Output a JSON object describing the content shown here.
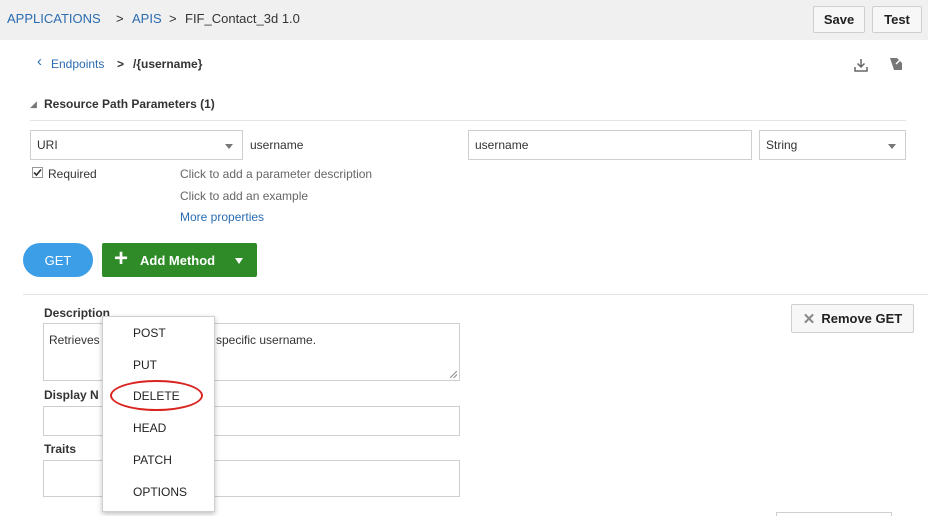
{
  "breadcrumb": {
    "applications": "APPLICATIONS",
    "sep1": ">",
    "apis": "APIS",
    "sep2": ">",
    "current": "FIF_Contact_3d  1.0"
  },
  "toolbar": {
    "save_label": "Save",
    "test_label": "Test"
  },
  "subnav": {
    "back_glyph": "‹",
    "endpoints_label": "Endpoints",
    "sep": ">",
    "path": "/{username}"
  },
  "section": {
    "toggle_glyph": "◢",
    "title": "Resource Path Parameters (1)"
  },
  "param": {
    "type_value": "URI",
    "name_value": "username",
    "display_value": "username",
    "datatype_value": "String",
    "required_label": "Required",
    "required_checked": true,
    "description_hint": "Click to add a parameter description",
    "example_hint": "Click to add an example",
    "more_properties": "More properties"
  },
  "methods": {
    "get_label": "GET",
    "add_plus": "+",
    "add_label": "Add Method"
  },
  "method_panel": {
    "description_label": "Description",
    "description_value_left": "Retrieves",
    "description_value_right": "specific username.",
    "display_name_label_visible": "Display N",
    "traits_label": "Traits",
    "remove_glyph": "✕",
    "remove_label": "Remove GET"
  },
  "dropdown": {
    "items": [
      "POST",
      "PUT",
      "DELETE",
      "HEAD",
      "PATCH",
      "OPTIONS"
    ],
    "highlighted": "DELETE"
  },
  "colors": {
    "get_pill": "#3d9ee8",
    "add_method": "#2e8b28",
    "highlight_ring": "#d9241f",
    "link": "#2b6cb0"
  }
}
